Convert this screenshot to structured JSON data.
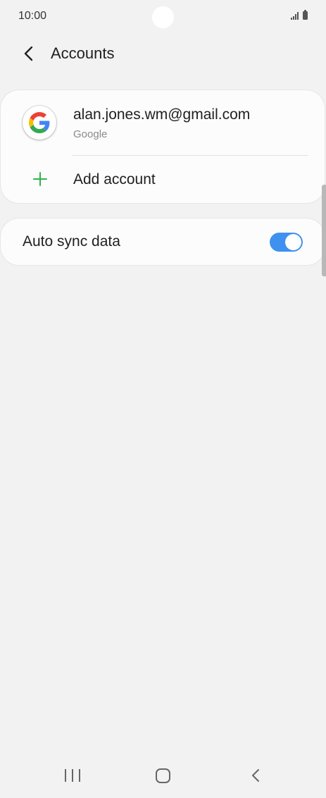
{
  "status_bar": {
    "time": "10:00"
  },
  "header": {
    "title": "Accounts"
  },
  "accounts": [
    {
      "email": "alan.jones.wm@gmail.com",
      "provider": "Google"
    }
  ],
  "add_account": {
    "label": "Add account"
  },
  "auto_sync": {
    "label": "Auto sync data",
    "enabled": true
  },
  "colors": {
    "background": "#f2f2f2",
    "card": "#fcfcfc",
    "toggle_on": "#3e91ee",
    "add_icon": "#2eb34a"
  },
  "icons": {
    "back": "chevron-left-icon",
    "google": "google-logo-icon",
    "add": "plus-icon",
    "signal": "signal-icon",
    "battery": "battery-icon"
  }
}
